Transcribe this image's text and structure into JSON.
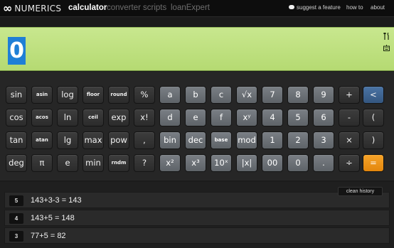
{
  "nav": {
    "logo_mark": "∞",
    "logo_text": "NUMERICS",
    "tabs": [
      "calculator",
      "converter",
      "scripts",
      "loanExpert"
    ],
    "suggest": "suggest a feature",
    "howto": "how to",
    "about": "about"
  },
  "display": {
    "value": "0",
    "icons": [
      "tools-icon",
      "keyboard-icon"
    ]
  },
  "keys": {
    "rows": [
      [
        "sin",
        "asin",
        "log",
        "floor",
        "round",
        "%",
        "a",
        "b",
        "c",
        "√x",
        "7",
        "8",
        "9",
        "+",
        "<"
      ],
      [
        "cos",
        "acos",
        "ln",
        "ceil",
        "exp",
        "x!",
        "d",
        "e",
        "f",
        "xʸ",
        "4",
        "5",
        "6",
        "-",
        "("
      ],
      [
        "tan",
        "atan",
        "lg",
        "max",
        "pow",
        ",",
        "bin",
        "dec",
        "base",
        "mod",
        "1",
        "2",
        "3",
        "×",
        ")"
      ],
      [
        "deg",
        "π",
        "e",
        "min",
        "rndm",
        "?",
        "x²",
        "x³",
        "10ˣ",
        "|x|",
        "00",
        "0",
        ".",
        "÷",
        "="
      ]
    ]
  },
  "history": {
    "clean_label": "clean history",
    "items": [
      {
        "index": "5",
        "expr": "143+3-3 = 143"
      },
      {
        "index": "4",
        "expr": "143+5 = 148"
      },
      {
        "index": "3",
        "expr": "77+5 = 82"
      }
    ]
  },
  "colors": {
    "display_bg": "#b9dc78",
    "value_bg": "#1f7fd6",
    "equals_key": "#f39a1d",
    "back_key": "#3f6592"
  }
}
